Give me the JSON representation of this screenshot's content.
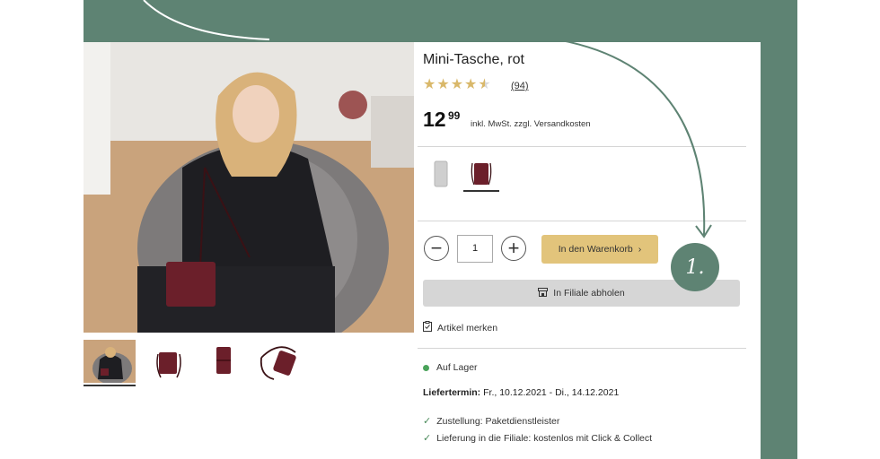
{
  "product": {
    "title": "Mini-Tasche, rot",
    "rating": 4.5,
    "review_count": "(94)",
    "price_int": "12",
    "price_dec": "99",
    "price_note": "inkl. MwSt. zzgl. Versandkosten"
  },
  "quantity": {
    "value": "1",
    "minus_label": "−",
    "plus_label": "+"
  },
  "buttons": {
    "add_to_cart": "In den Warenkorb",
    "add_to_cart_arrow": "›",
    "store_pickup": "In Filiale abholen",
    "wishlist": "Artikel merken"
  },
  "step_badge": "1.",
  "availability": {
    "stock": "Auf Lager",
    "delivery_label": "Liefertermin:",
    "delivery_dates": "Fr., 10.12.2021 - Di., 14.12.2021"
  },
  "features": [
    "Zustellung: Paketdienstleister",
    "Lieferung in die Filiale: kostenlos mit Click & Collect"
  ],
  "colors": {
    "brand_green": "#5e8373",
    "cart_button": "#e2c47b",
    "store_button": "#d6d6d6",
    "star": "#d9b86a",
    "in_stock_dot": "#4aa35a",
    "bag": "#6b1f2a"
  },
  "icons": {
    "minus": "minus-icon",
    "plus": "plus-icon",
    "arrow": "chevron-right-icon",
    "store": "store-icon",
    "wishlist": "clipboard-check-icon",
    "check": "check-icon"
  }
}
